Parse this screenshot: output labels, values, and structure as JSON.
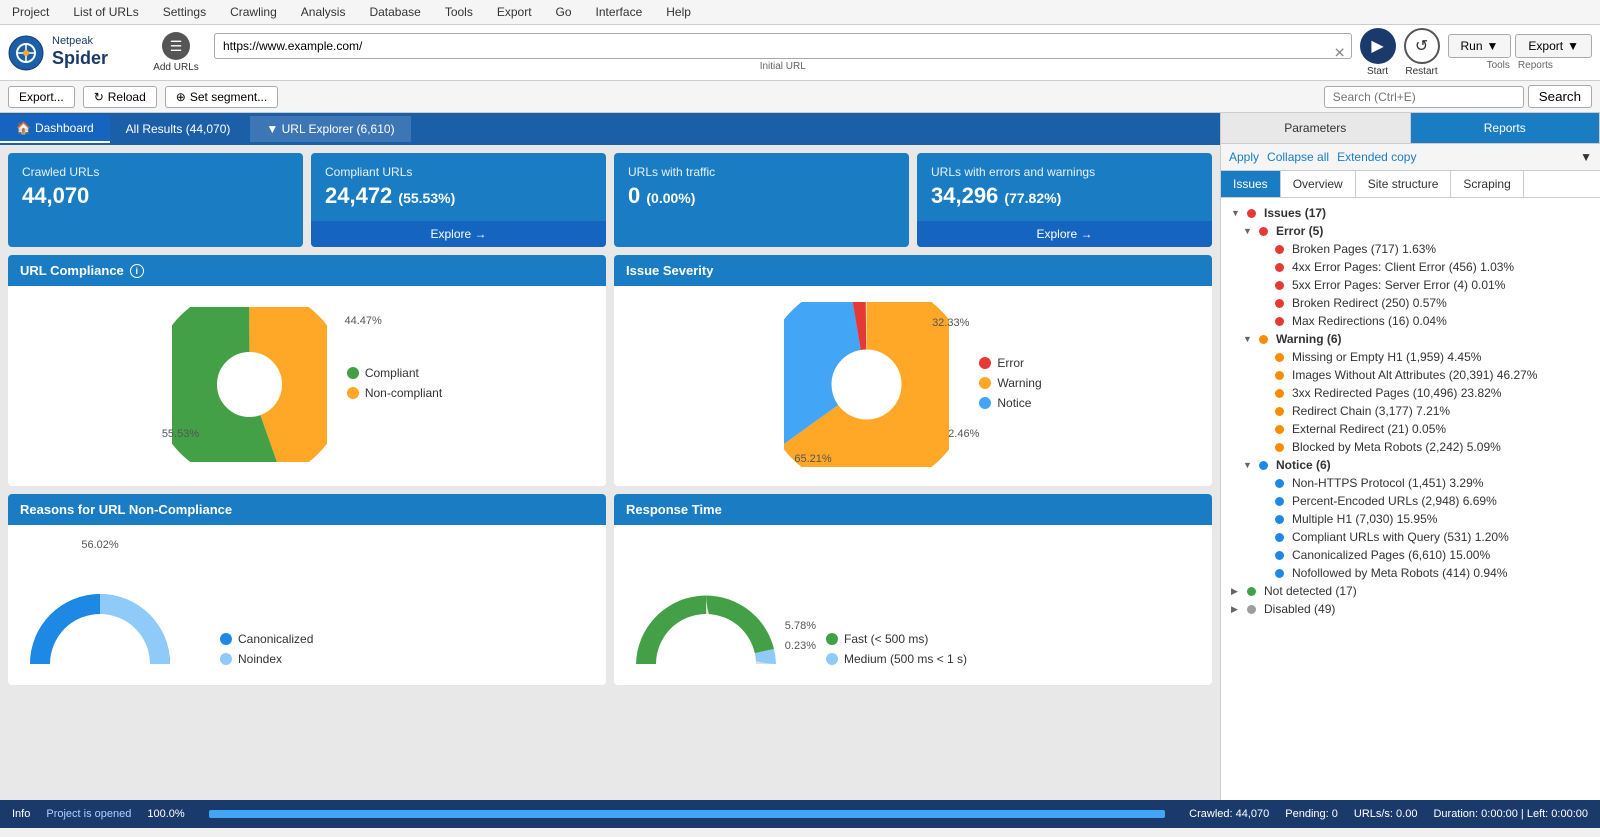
{
  "menu": {
    "items": [
      "Project",
      "List of URLs",
      "Settings",
      "Crawling",
      "Analysis",
      "Database",
      "Tools",
      "Export",
      "Go",
      "Interface",
      "Help"
    ]
  },
  "header": {
    "logo_top": "Netpeak",
    "logo_bottom": "Spider",
    "add_urls_label": "Add URLs",
    "url": "https://www.example.com/",
    "url_label": "Initial URL",
    "start_label": "Start",
    "restart_label": "Restart",
    "run_label": "Run",
    "tools_label": "Tools",
    "export_label": "Export",
    "reports_label": "Reports"
  },
  "toolbar": {
    "export_label": "Export...",
    "reload_label": "Reload",
    "set_segment_label": "Set segment...",
    "search_placeholder": "Search (Ctrl+E)",
    "search_btn": "Search"
  },
  "tabs": {
    "dashboard": "Dashboard",
    "all_results": "All Results (44,070)",
    "url_explorer": "URL Explorer (6,610)"
  },
  "stats": [
    {
      "label": "Crawled URLs",
      "value": "44,070",
      "sub": "",
      "has_explore": false
    },
    {
      "label": "Compliant URLs",
      "value": "24,472",
      "sub": "(55.53%)",
      "has_explore": true
    },
    {
      "label": "URLs with traffic",
      "value": "0",
      "sub": "(0.00%)",
      "has_explore": false
    },
    {
      "label": "URLs with errors and warnings",
      "value": "34,296",
      "sub": "(77.82%)",
      "has_explore": true
    }
  ],
  "url_compliance": {
    "title": "URL Compliance",
    "segments": [
      {
        "label": "Compliant",
        "color": "#43a047",
        "percent": 55.53,
        "angle": 200
      },
      {
        "label": "Non-compliant",
        "color": "#ffa726",
        "percent": 44.47,
        "angle": 160
      }
    ],
    "label_top": "44.47%",
    "label_bottom": "55.53%"
  },
  "issue_severity": {
    "title": "Issue Severity",
    "segments": [
      {
        "label": "Error",
        "color": "#e53935",
        "percent": 2.46
      },
      {
        "label": "Warning",
        "color": "#ffa726",
        "percent": 65.21
      },
      {
        "label": "Notice",
        "color": "#42a5f5",
        "percent": 32.33
      }
    ],
    "label_top": "32.33%",
    "label_mid": "2.46%",
    "label_bottom": "65.21%"
  },
  "non_compliance": {
    "title": "Reasons for URL Non-Compliance",
    "label_top": "56.02%",
    "legends": [
      {
        "label": "Canonicalized",
        "color": "#1e88e5"
      },
      {
        "label": "Noindex",
        "color": "#90caf9"
      }
    ]
  },
  "response_time": {
    "title": "Response Time",
    "legends": [
      {
        "label": "Fast (< 500 ms)",
        "color": "#43a047"
      },
      {
        "label": "Medium (500 ms < 1 s)",
        "color": "#90caf9"
      }
    ],
    "label1": "5.78%",
    "label2": "0.23%"
  },
  "panel": {
    "tabs": [
      "Parameters",
      "Reports"
    ],
    "active_tab": "Reports",
    "actions": [
      "Apply",
      "Collapse all",
      "Extended copy"
    ],
    "issue_tabs": [
      "Issues",
      "Overview",
      "Site structure",
      "Scraping"
    ],
    "active_issue_tab": "Issues"
  },
  "tree": {
    "items": [
      {
        "level": 0,
        "arrow": "▼",
        "dot": "red",
        "text": "Issues (17)",
        "bold": true
      },
      {
        "level": 1,
        "arrow": "▼",
        "dot": "red",
        "text": "Error (5)",
        "bold": true
      },
      {
        "level": 2,
        "arrow": "",
        "dot": "red",
        "text": "Broken Pages (717) 1.63%"
      },
      {
        "level": 2,
        "arrow": "",
        "dot": "red",
        "text": "4xx Error Pages: Client Error (456) 1.03%"
      },
      {
        "level": 2,
        "arrow": "",
        "dot": "red",
        "text": "5xx Error Pages: Server Error (4) 0.01%"
      },
      {
        "level": 2,
        "arrow": "",
        "dot": "red",
        "text": "Broken Redirect (250) 0.57%"
      },
      {
        "level": 2,
        "arrow": "",
        "dot": "red",
        "text": "Max Redirections (16) 0.04%"
      },
      {
        "level": 1,
        "arrow": "▼",
        "dot": "orange",
        "text": "Warning (6)",
        "bold": true
      },
      {
        "level": 2,
        "arrow": "",
        "dot": "orange",
        "text": "Missing or Empty H1 (1,959) 4.45%"
      },
      {
        "level": 2,
        "arrow": "",
        "dot": "orange",
        "text": "Images Without Alt Attributes (20,391) 46.27%"
      },
      {
        "level": 2,
        "arrow": "",
        "dot": "orange",
        "text": "3xx Redirected Pages (10,496) 23.82%"
      },
      {
        "level": 2,
        "arrow": "",
        "dot": "orange",
        "text": "Redirect Chain (3,177) 7.21%"
      },
      {
        "level": 2,
        "arrow": "",
        "dot": "orange",
        "text": "External Redirect (21) 0.05%"
      },
      {
        "level": 2,
        "arrow": "",
        "dot": "orange",
        "text": "Blocked by Meta Robots (2,242) 5.09%"
      },
      {
        "level": 1,
        "arrow": "▼",
        "dot": "blue",
        "text": "Notice (6)",
        "bold": true
      },
      {
        "level": 2,
        "arrow": "",
        "dot": "blue",
        "text": "Non-HTTPS Protocol (1,451) 3.29%"
      },
      {
        "level": 2,
        "arrow": "",
        "dot": "blue",
        "text": "Percent-Encoded URLs (2,948) 6.69%"
      },
      {
        "level": 2,
        "arrow": "",
        "dot": "blue",
        "text": "Multiple H1 (7,030) 15.95%"
      },
      {
        "level": 2,
        "arrow": "",
        "dot": "blue",
        "text": "Compliant URLs with Query (531) 1.20%"
      },
      {
        "level": 2,
        "arrow": "",
        "dot": "blue",
        "text": "Canonicalized Pages (6,610) 15.00%"
      },
      {
        "level": 2,
        "arrow": "",
        "dot": "blue",
        "text": "Nofollowed by Meta Robots (414) 0.94%"
      },
      {
        "level": 0,
        "arrow": "▶",
        "dot": "green",
        "text": "Not detected (17)",
        "bold": false
      },
      {
        "level": 0,
        "arrow": "▶",
        "dot": "gray",
        "text": "Disabled (49)",
        "bold": false
      }
    ]
  },
  "statusbar": {
    "info": "Info",
    "project_status": "Project is opened",
    "progress_percent": "100.0%",
    "progress_fill": 100,
    "crawled": "Crawled: 44,070",
    "pending": "Pending: 0",
    "urls_s": "URLs/s: 0.00",
    "duration": "Duration: 0:00:00 | Left: 0:00:00"
  }
}
